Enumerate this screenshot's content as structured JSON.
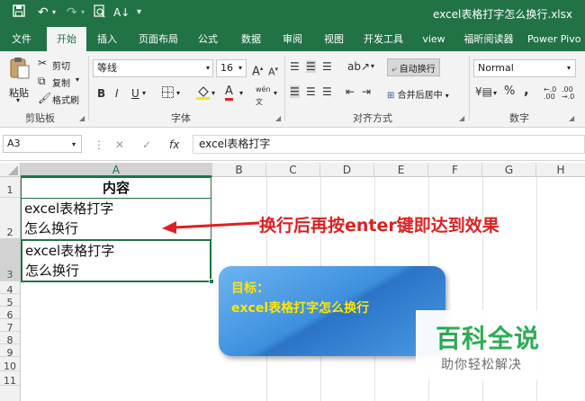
{
  "titlebar": {
    "save_icon": "save-icon",
    "undo_icon": "undo-icon",
    "redo_icon": "redo-icon",
    "preview_icon": "print-preview-icon",
    "sort_icon": "sort-icon",
    "more_icon": "customize-quick-access-icon",
    "title": "excel表格打字怎么换行.xlsx"
  },
  "tabs": [
    "文件",
    "开始",
    "插入",
    "页面布局",
    "公式",
    "数据",
    "审阅",
    "视图",
    "开发工具",
    "view",
    "福昕阅读器",
    "Power Pivo"
  ],
  "ribbon": {
    "clipboard": {
      "group": "剪贴板",
      "paste": "粘贴",
      "cut": "剪切",
      "copy": "复制",
      "format_painter": "格式刷"
    },
    "font": {
      "group": "字体",
      "name": "等线",
      "size": "16",
      "bold": "B",
      "italic": "I",
      "underline": "U",
      "grow": "A",
      "shrink": "A",
      "font_color": "A",
      "phonetic": "wén"
    },
    "alignment": {
      "group": "对齐方式",
      "wrap": "自动换行",
      "merge": "合并后居中"
    },
    "number": {
      "group": "数字",
      "format": "Normal",
      "currency": "¥",
      "percent": "%",
      "comma": ","
    }
  },
  "formula_bar": {
    "name_box": "A3",
    "fx": "fx",
    "content": "excel表格打字"
  },
  "columns": [
    "A",
    "B",
    "C",
    "D",
    "E",
    "F",
    "G",
    "H"
  ],
  "rows": [
    "1",
    "2",
    "3",
    "4",
    "5",
    "6",
    "7",
    "8",
    "9",
    "10",
    "11"
  ],
  "cells": {
    "a1": "内容",
    "a2_line1": "excel表格打字",
    "a2_line2": "怎么换行",
    "a3_line1": "excel表格打字",
    "a3_line2": "怎么换行"
  },
  "annotation": "换行后再按enter键即达到效果",
  "callout": {
    "line1": "目标：",
    "line2": "excel表格打字怎么换行"
  },
  "watermark": {
    "title": "百科全说",
    "subtitle": "助你轻松解决"
  },
  "colors": {
    "excel_green": "#217346",
    "annotation_red": "#e02020",
    "callout_blue": "#3d8fdd",
    "callout_text": "#ffe600",
    "watermark_green": "#23a84a"
  }
}
